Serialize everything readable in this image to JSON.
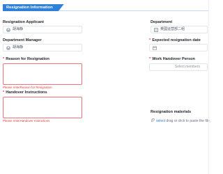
{
  "section": {
    "title": "Resignation Information"
  },
  "fields": {
    "applicant": {
      "label": "Resignation Applicant",
      "value": "胡海静"
    },
    "department": {
      "label": "Department",
      "value": "英國运营部二组"
    },
    "manager": {
      "label": "Department Manager",
      "value": "胡海静"
    },
    "expected_date": {
      "label": "Expected resignation date",
      "required": true
    },
    "handover_person": {
      "label": "Work Handover Person",
      "required": true,
      "placeholder": "Select members"
    },
    "reason": {
      "label": "Reason for Resignation",
      "required": true,
      "error": "Please enterReason for Resignation"
    },
    "handover_instructions": {
      "label": "Handover Instructions",
      "required": true,
      "error": "Please enterHandover Instructions"
    },
    "materials": {
      "label": "Resignation materials",
      "select_link": "select",
      "hint": "drag or click to paste the file,"
    }
  },
  "colors": {
    "accent": "#2f80d8",
    "error": "#e23c39",
    "required": "#e23c39",
    "border": "#e2e5ea"
  },
  "icons": [
    "user-avatar-icon",
    "department-icon",
    "calendar-icon",
    "paperclip-icon"
  ]
}
